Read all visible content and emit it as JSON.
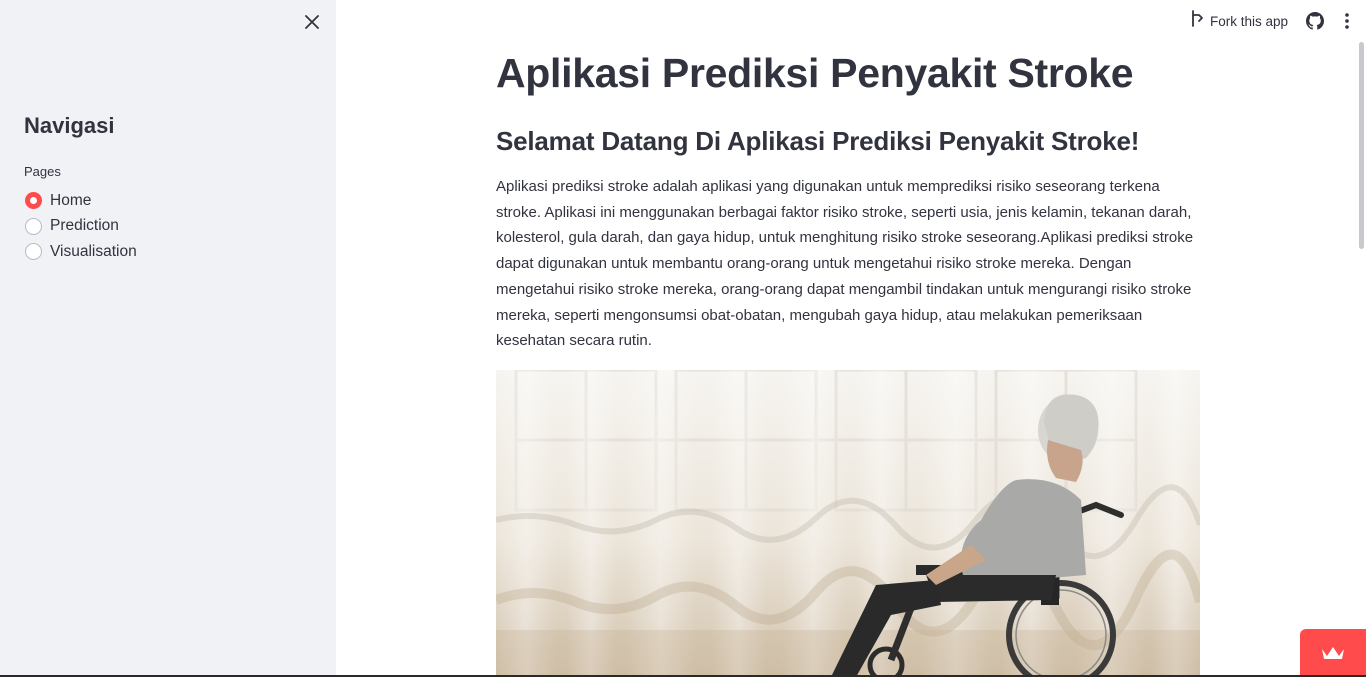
{
  "sidebar": {
    "title": "Navigasi",
    "pages_label": "Pages",
    "options": [
      {
        "label": "Home",
        "selected": true
      },
      {
        "label": "Prediction",
        "selected": false
      },
      {
        "label": "Visualisation",
        "selected": false
      }
    ],
    "close_icon": "close-icon"
  },
  "toolbar": {
    "fork_label": "Fork this app",
    "fork_icon": "fork-icon",
    "github_icon": "github-icon",
    "menu_icon": "kebab-menu-icon"
  },
  "main": {
    "title": "Aplikasi Prediksi Penyakit Stroke",
    "subheader": "Selamat Datang Di Aplikasi Prediksi Penyakit Stroke!",
    "intro": "Aplikasi prediksi stroke adalah aplikasi yang digunakan untuk memprediksi risiko seseorang terkena stroke. Aplikasi ini menggunakan berbagai faktor risiko stroke, seperti usia, jenis kelamin, tekanan darah, kolesterol, gula darah, dan gaya hidup, untuk menghitung risiko stroke seseorang.Aplikasi prediksi stroke dapat digunakan untuk membantu orang-orang untuk mengetahui risiko stroke mereka. Dengan mengetahui risiko stroke mereka, orang-orang dapat mengambil tindakan untuk mengurangi risiko stroke mereka, seperti mengonsumsi obat-obatan, mengubah gaya hidup, atau melakukan pemeriksaan kesehatan secara rutin.",
    "image_icon": "elderly-wheelchair-photo"
  },
  "colors": {
    "accent": "#ff4b4b",
    "sidebar_bg": "#f0f2f6",
    "text": "#31333f"
  }
}
